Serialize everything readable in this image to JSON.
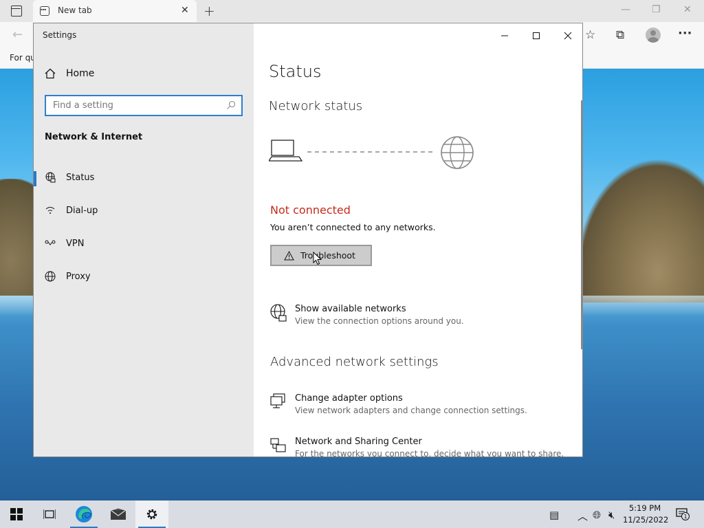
{
  "browser": {
    "tab_title": "New tab",
    "favbar_text": "For qu"
  },
  "settings": {
    "window_title": "Settings",
    "home_label": "Home",
    "search_placeholder": "Find a setting",
    "section_title": "Network & Internet",
    "nav_items": [
      {
        "label": "Status",
        "icon": "status-globe-icon",
        "active": true
      },
      {
        "label": "Dial-up",
        "icon": "dialup-icon",
        "active": false
      },
      {
        "label": "VPN",
        "icon": "vpn-icon",
        "active": false
      },
      {
        "label": "Proxy",
        "icon": "proxy-globe-icon",
        "active": false
      }
    ],
    "page_title": "Status",
    "network_status_heading": "Network status",
    "connection_status": "Not connected",
    "connection_description": "You aren’t connected to any networks.",
    "troubleshoot_label": "Troubleshoot",
    "show_networks": {
      "title": "Show available networks",
      "description": "View the connection options around you."
    },
    "advanced_heading": "Advanced network settings",
    "adapter_options": {
      "title": "Change adapter options",
      "description": "View network adapters and change connection settings."
    },
    "sharing_center": {
      "title": "Network and Sharing Center",
      "description": "For the networks you connect to, decide what you want to share."
    }
  },
  "taskbar": {
    "time": "5:19 PM",
    "date": "11/25/2022",
    "notification_count": "1"
  },
  "colors": {
    "accent": "#2b79c8",
    "error": "#c42b1c",
    "sidebar_bg": "#e9e9e9"
  }
}
